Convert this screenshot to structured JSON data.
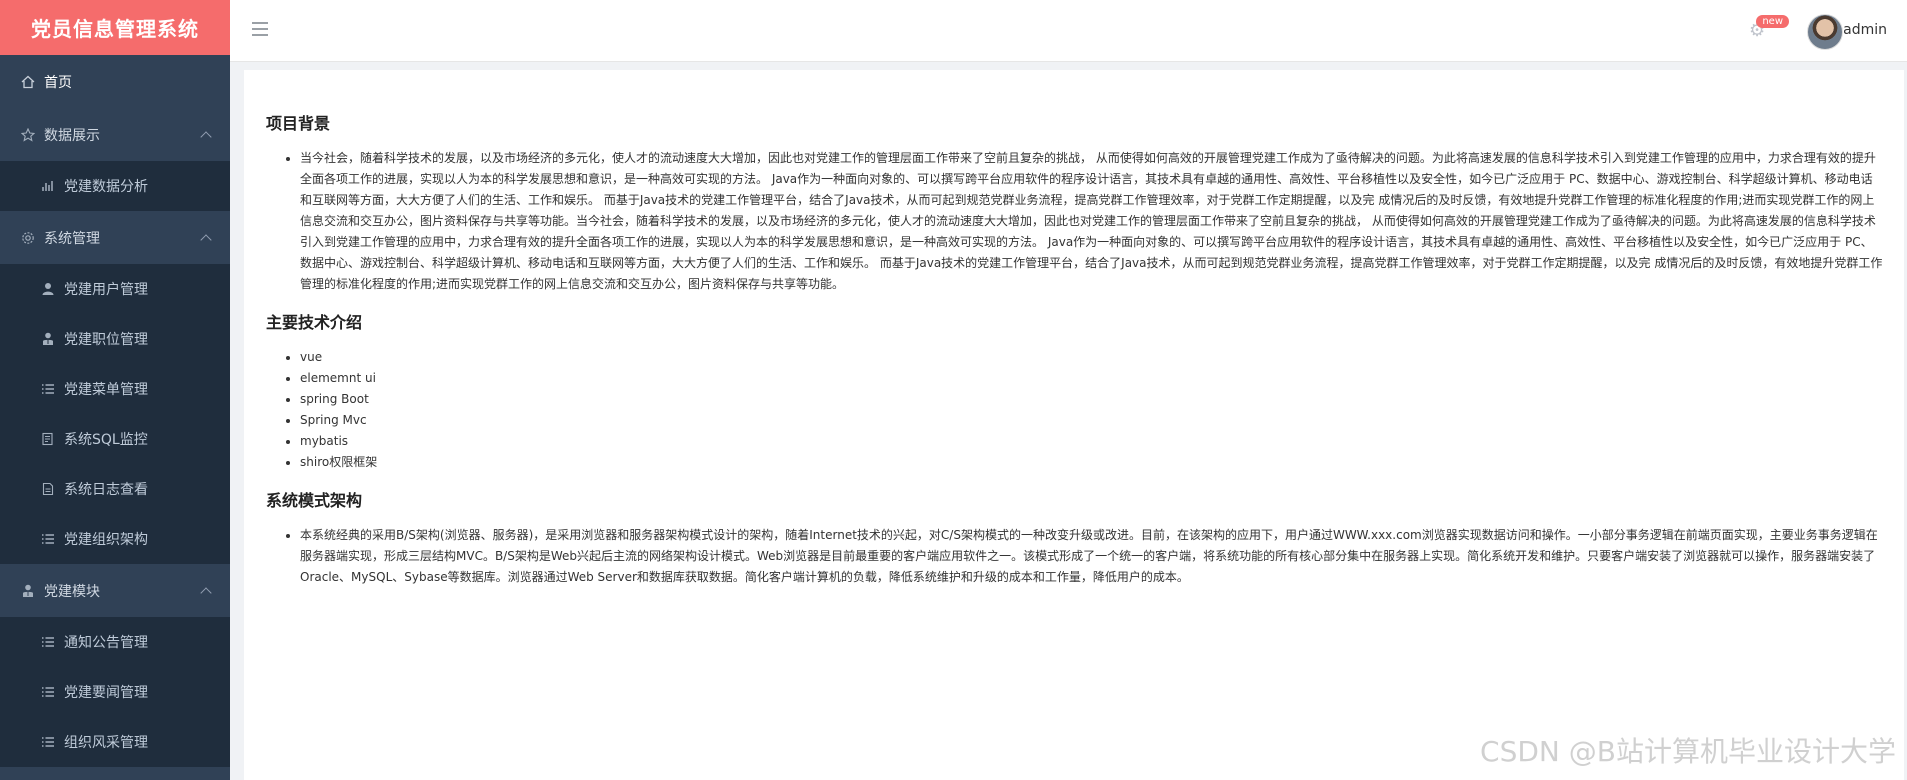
{
  "sidebar": {
    "brand": "党员信息管理系统",
    "items": [
      {
        "label": "首页",
        "icon": "home-icon",
        "type": "item"
      },
      {
        "label": "数据展示",
        "icon": "star-icon",
        "type": "group"
      },
      {
        "label": "党建数据分析",
        "icon": "bar-chart-icon",
        "type": "sub"
      },
      {
        "label": "系统管理",
        "icon": "gear-icon",
        "type": "group"
      },
      {
        "label": "党建用户管理",
        "icon": "user-icon",
        "type": "sub"
      },
      {
        "label": "党建职位管理",
        "icon": "user-tie-icon",
        "type": "sub"
      },
      {
        "label": "党建菜单管理",
        "icon": "list-icon",
        "type": "sub"
      },
      {
        "label": "系统SQL监控",
        "icon": "monitor-icon",
        "type": "sub"
      },
      {
        "label": "系统日志查看",
        "icon": "document-icon",
        "type": "sub"
      },
      {
        "label": "党建组织架构",
        "icon": "list-icon",
        "type": "sub"
      },
      {
        "label": "党建模块",
        "icon": "user-tie-icon",
        "type": "group"
      },
      {
        "label": "通知公告管理",
        "icon": "list-icon",
        "type": "sub"
      },
      {
        "label": "党建要闻管理",
        "icon": "list-icon",
        "type": "sub"
      },
      {
        "label": "组织风采管理",
        "icon": "list-icon",
        "type": "sub"
      }
    ]
  },
  "header": {
    "badge": "new",
    "username": "admin"
  },
  "main": {
    "section1_title": "项目背景",
    "section1_text": "当今社会，随着科学技术的发展，以及市场经济的多元化，使人才的流动速度大大增加，因此也对党建工作的管理层面工作带来了空前且复杂的挑战，  从而使得如何高效的开展管理党建工作成为了亟待解决的问题。为此将高速发展的信息科学技术引入到党建工作管理的应用中，力求合理有效的提升全面各项工作的进展，实现以人为本的科学发展思想和意识，是一种高效可实现的方法。 Java作为一种面向对象的、可以撰写跨平台应用软件的程序设计语言，其技术具有卓越的通用性、高效性、平台移植性以及安全性，如今已广泛应用于 PC、数据中心、游戏控制台、科学超级计算机、移动电话和互联网等方面，大大方便了人们的生活、工作和娱乐。 而基于Java技术的党建工作管理平台，结合了Java技术，从而可起到规范党群业务流程，提高党群工作管理效率，对于党群工作定期提醒，以及完 成情况后的及时反馈，有效地提升党群工作管理的标准化程度的作用;进而实现党群工作的网上信息交流和交互办公，图片资料保存与共享等功能。当今社会，随着科学技术的发展，以及市场经济的多元化，使人才的流动速度大大增加，因此也对党建工作的管理层面工作带来了空前且复杂的挑战，  从而使得如何高效的开展管理党建工作成为了亟待解决的问题。为此将高速发展的信息科学技术引入到党建工作管理的应用中，力求合理有效的提升全面各项工作的进展，实现以人为本的科学发展思想和意识，是一种高效可实现的方法。 Java作为一种面向对象的、可以撰写跨平台应用软件的程序设计语言，其技术具有卓越的通用性、高效性、平台移植性以及安全性，如今已广泛应用于 PC、数据中心、游戏控制台、科学超级计算机、移动电话和互联网等方面，大大方便了人们的生活、工作和娱乐。 而基于Java技术的党建工作管理平台，结合了Java技术，从而可起到规范党群业务流程，提高党群工作管理效率，对于党群工作定期提醒，以及完 成情况后的及时反馈，有效地提升党群工作管理的标准化程度的作用;进而实现党群工作的网上信息交流和交互办公，图片资料保存与共享等功能。",
    "section2_title": "主要技术介绍",
    "tech": [
      "vue",
      "elememnt ui",
      "spring Boot",
      "Spring Mvc",
      "mybatis",
      "shiro权限框架"
    ],
    "section3_title": "系统模式架构",
    "section3_text": "本系统经典的采用B/S架构(浏览器、服务器)，是采用浏览器和服务器架构模式设计的架构，随着Internet技术的兴起，对C/S架构模式的一种改变升级或改进。目前，在该架构的应用下，用户通过WWW.xxx.com浏览器实现数据访问和操作。一小部分事务逻辑在前端页面实现，主要业务事务逻辑在服务器端实现，形成三层结构MVC。B/S架构是Web兴起后主流的网络架构设计模式。Web浏览器是目前最重要的客户端应用软件之一。该模式形成了一个统一的客户端，将系统功能的所有核心部分集中在服务器上实现。简化系统开发和维护。只要客户端安装了浏览器就可以操作，服务器端安装了Oracle、MySQL、Sybase等数据库。浏览器通过Web Server和数据库获取数据。简化客户端计算机的负载，降低系统维护和升级的成本和工作量，降低用户的成本。"
  },
  "watermark": "CSDN @B站计算机毕业设计大学"
}
